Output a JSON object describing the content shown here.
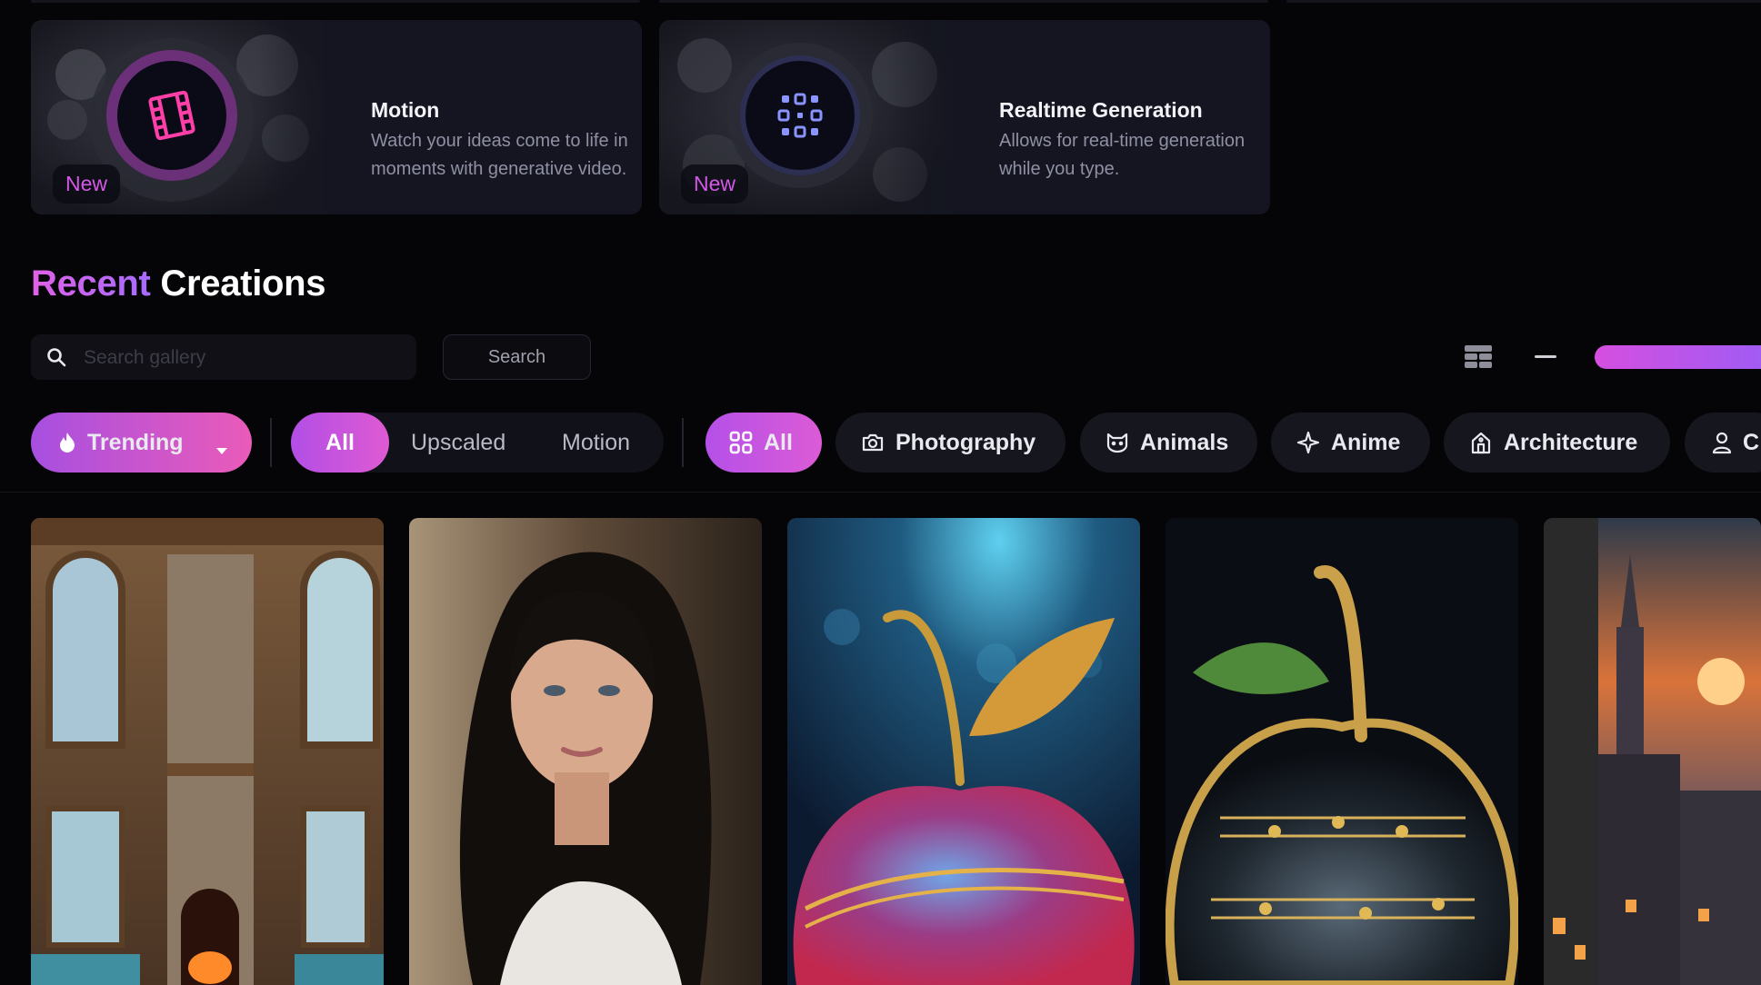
{
  "features": [
    {
      "title": "Motion",
      "description": "Watch your ideas come to life in moments with generative video.",
      "badge": "New",
      "icon": "film-strip-icon"
    },
    {
      "title": "Realtime Generation",
      "description": "Allows for real-time generation while you type.",
      "badge": "New",
      "icon": "realtime-grid-icon"
    }
  ],
  "section": {
    "title_accent": "Recent",
    "title_rest": "Creations"
  },
  "search": {
    "placeholder": "Search gallery",
    "button_label": "Search"
  },
  "sort": {
    "label": "Trending",
    "icon": "flame-icon"
  },
  "media_filter": {
    "options": [
      "All",
      "Upscaled",
      "Motion"
    ],
    "selected": "All"
  },
  "categories": [
    {
      "label": "All",
      "icon": "grid-icon",
      "active": true
    },
    {
      "label": "Photography",
      "icon": "camera-icon"
    },
    {
      "label": "Animals",
      "icon": "cat-icon"
    },
    {
      "label": "Anime",
      "icon": "sparkle-icon"
    },
    {
      "label": "Architecture",
      "icon": "building-icon"
    },
    {
      "label": "C",
      "icon": "user-icon"
    }
  ],
  "gallery": [
    {
      "image": "cozy-castle-interior-with-fireplace"
    },
    {
      "image": "portrait-of-dark-haired-woman"
    },
    {
      "image": "glass-apple-with-music-notes"
    },
    {
      "image": "crystal-apple-with-golden-score"
    },
    {
      "image": "fantasy-city-at-sunset"
    }
  ],
  "colors": {
    "accent_start": "#b24ee6",
    "accent_end": "#e45bc6",
    "background": "#050507",
    "card": "#141521"
  }
}
